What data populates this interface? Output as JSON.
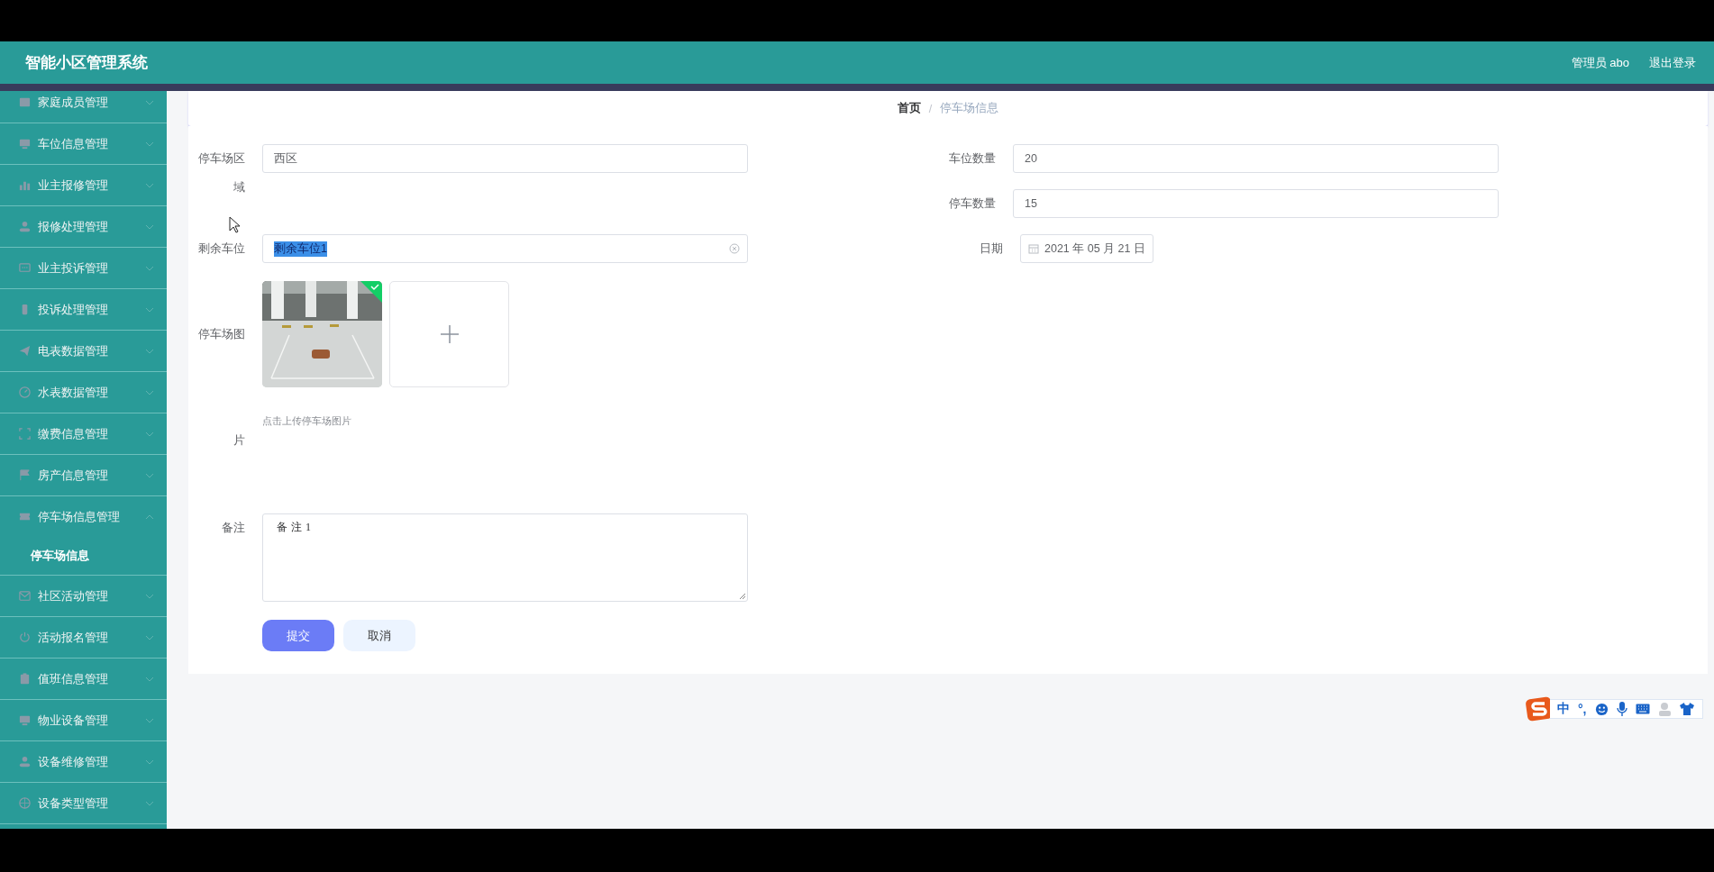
{
  "header": {
    "title": "智能小区管理系统",
    "user": "管理员 abo",
    "logout": "退出登录"
  },
  "sidebar": {
    "items": [
      {
        "label": "家庭成员管理",
        "expanded": false
      },
      {
        "label": "车位信息管理",
        "expanded": false
      },
      {
        "label": "业主报修管理",
        "expanded": false
      },
      {
        "label": "报修处理管理",
        "expanded": false
      },
      {
        "label": "业主投诉管理",
        "expanded": false
      },
      {
        "label": "投诉处理管理",
        "expanded": false
      },
      {
        "label": "电表数据管理",
        "expanded": false
      },
      {
        "label": "水表数据管理",
        "expanded": false
      },
      {
        "label": "缴费信息管理",
        "expanded": false
      },
      {
        "label": "房产信息管理",
        "expanded": false
      },
      {
        "label": "停车场信息管理",
        "expanded": true,
        "children": [
          {
            "label": "停车场信息",
            "selected": true
          }
        ]
      },
      {
        "label": "社区活动管理",
        "expanded": false
      },
      {
        "label": "活动报名管理",
        "expanded": false
      },
      {
        "label": "值班信息管理",
        "expanded": false
      },
      {
        "label": "物业设备管理",
        "expanded": false
      },
      {
        "label": "设备维修管理",
        "expanded": false
      },
      {
        "label": "设备类型管理",
        "expanded": false
      }
    ]
  },
  "breadcrumb": {
    "separator": "/",
    "items": [
      {
        "label": "首页",
        "current": false
      },
      {
        "label": "停车场信息",
        "current": true
      }
    ]
  },
  "form": {
    "left_fields": [
      {
        "kind": "text",
        "label": "停车场区域",
        "value": "西区"
      },
      {
        "kind": "text",
        "label": "剩余车位",
        "value": "剩余车位1",
        "text_selected": true,
        "clearable": true
      },
      {
        "kind": "image_upload",
        "label": "停车场图片",
        "images": [
          {
            "kind": "picture",
            "uploaded": true
          }
        ],
        "hint": "点击上传停车场图片"
      },
      {
        "kind": "textarea",
        "label": "备注",
        "value": "备注1"
      }
    ],
    "right_fields": [
      {
        "kind": "text",
        "label": "车位数量",
        "value": "20"
      },
      {
        "kind": "text",
        "label": "停车数量",
        "value": "15"
      },
      {
        "kind": "date",
        "label": "日期",
        "value": "2021 年 05 月 21 日"
      }
    ],
    "buttons": [
      {
        "kind": "primary",
        "label": "提交"
      },
      {
        "kind": "plain",
        "label": "取消"
      }
    ]
  },
  "ime_toolbar": {
    "mode": "中",
    "punctuation": "°,"
  }
}
